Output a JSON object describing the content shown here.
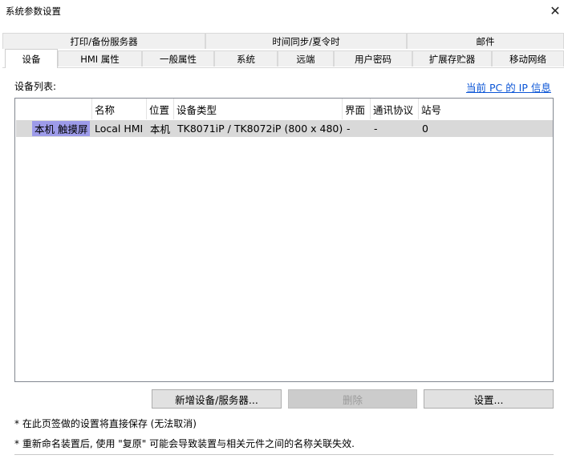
{
  "window": {
    "title": "系统参数设置"
  },
  "tabs_row1": [
    "打印/备份服务器",
    "时间同步/夏令时",
    "邮件"
  ],
  "tabs_row2": [
    "设备",
    "HMI 属性",
    "一般属性",
    "系统",
    "远端",
    "用户密码",
    "扩展存贮器",
    "移动网络"
  ],
  "device_panel": {
    "list_label": "设备列表:",
    "ip_link": "当前 PC 的 IP 信息",
    "columns": [
      "名称",
      "位置",
      "设备类型",
      "界面",
      "通讯协议",
      "站号"
    ],
    "rows": [
      {
        "group": "本机 触摸屏",
        "name": "Local HMI",
        "location": "本机",
        "type": "TK8071iP / TK8072iP (800 x 480)",
        "interface": "-",
        "protocol": "-",
        "station": "0"
      }
    ],
    "buttons": {
      "add": "新增设备/服务器...",
      "delete": "删除",
      "settings": "设置..."
    },
    "notes": [
      "* 在此页签做的设置将直接保存 (无法取消)",
      "* 重新命名装置后, 使用 \"复原\" 可能会导致装置与相关元件之间的名称关联失效."
    ]
  },
  "colors": {
    "selection": "#9d9be9",
    "row_bg": "#d9d9d9",
    "link": "#0b55d6"
  }
}
